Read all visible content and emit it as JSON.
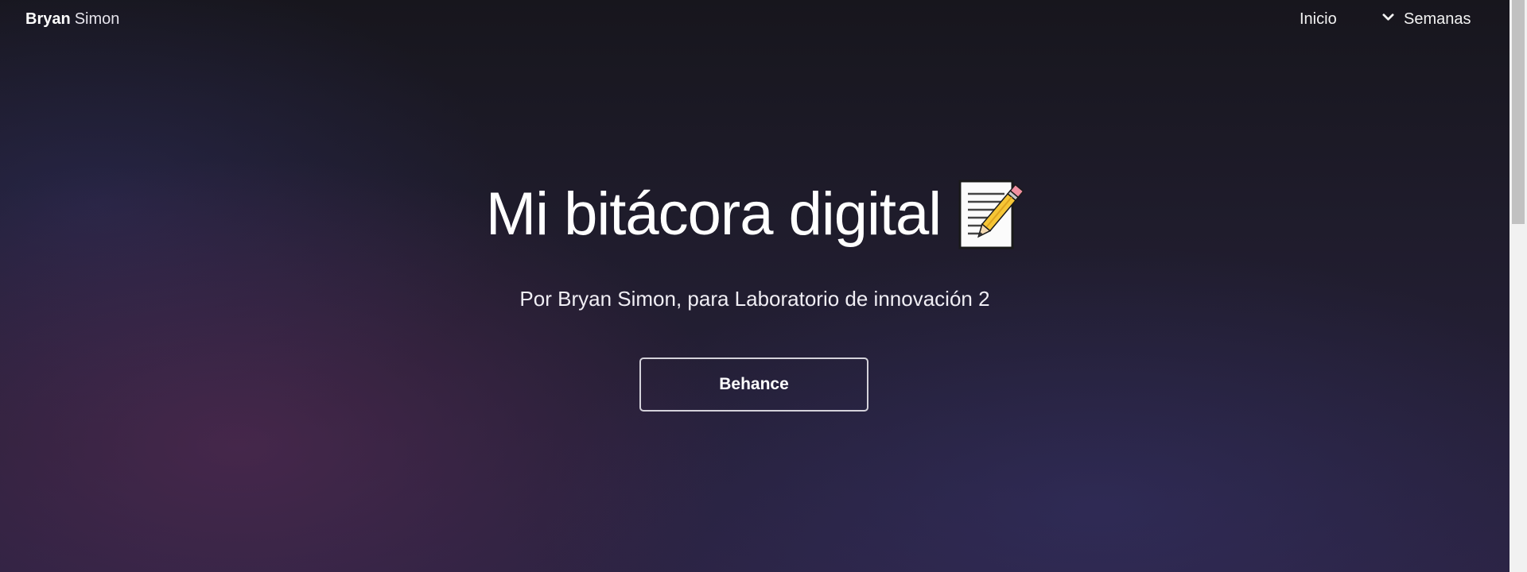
{
  "navbar": {
    "brand_first": "Bryan",
    "brand_last": "Simon",
    "links": [
      {
        "label": "Inicio"
      },
      {
        "label": "Semanas",
        "icon": "chevron-down-icon"
      }
    ]
  },
  "hero": {
    "title": "Mi bitácora digital",
    "title_icon": "memo-icon",
    "subtitle": "Por Bryan Simon, para Laboratorio de innovación 2",
    "button_label": "Behance"
  },
  "colors": {
    "background": "#1e1b2c",
    "text": "#ffffff",
    "button_border": "#d4d2da"
  }
}
